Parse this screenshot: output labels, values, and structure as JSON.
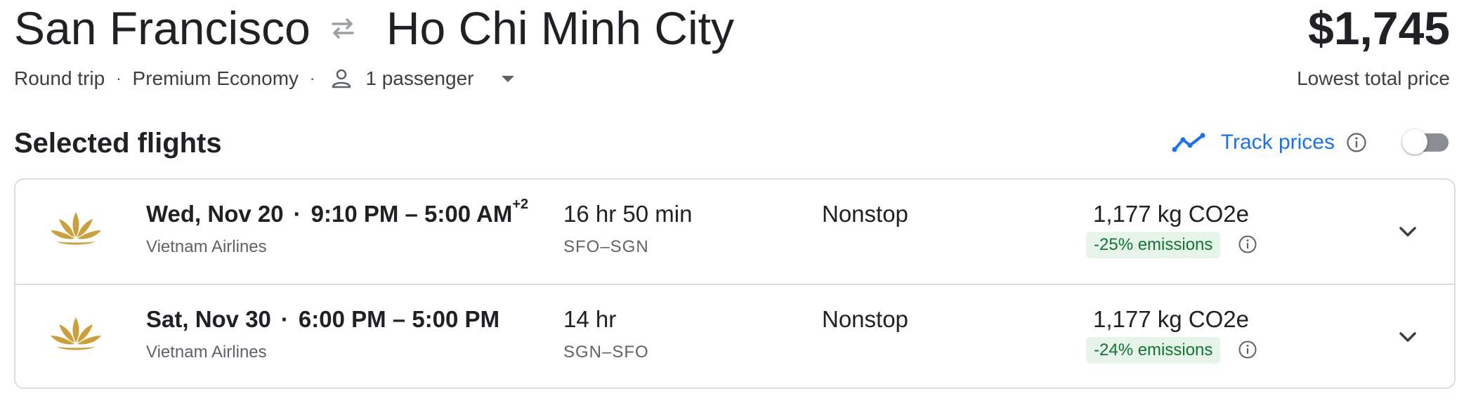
{
  "header": {
    "origin": "San Francisco",
    "destination": "Ho Chi Minh City",
    "swap_icon": "swap-arrows-icon",
    "price": "$1,745",
    "price_caption": "Lowest total price"
  },
  "meta": {
    "trip_type": "Round trip",
    "cabin_class": "Premium Economy",
    "passengers": "1 passenger",
    "separator": "·"
  },
  "section": {
    "title": "Selected flights",
    "track_prices_label": "Track prices",
    "track_prices_enabled": false
  },
  "flights": [
    {
      "date": "Wed, Nov 20",
      "depart": "9:10 PM",
      "arrive": "5:00 AM",
      "day_offset": "+2",
      "airline": "Vietnam Airlines",
      "duration": "16 hr 50 min",
      "route": "SFO–SGN",
      "stops": "Nonstop",
      "co2": "1,177 kg CO2e",
      "emissions_badge": "-25% emissions"
    },
    {
      "date": "Sat, Nov 30",
      "depart": "6:00 PM",
      "arrive": "5:00 PM",
      "day_offset": "",
      "airline": "Vietnam Airlines",
      "duration": "14 hr",
      "route": "SGN–SFO",
      "stops": "Nonstop",
      "co2": "1,177 kg CO2e",
      "emissions_badge": "-24% emissions"
    }
  ],
  "colors": {
    "accent": "#1a73e8",
    "logo_gold": "#c9a03c",
    "badge_bg": "#e6f4ea",
    "badge_text": "#137333",
    "border": "#dadce0"
  }
}
